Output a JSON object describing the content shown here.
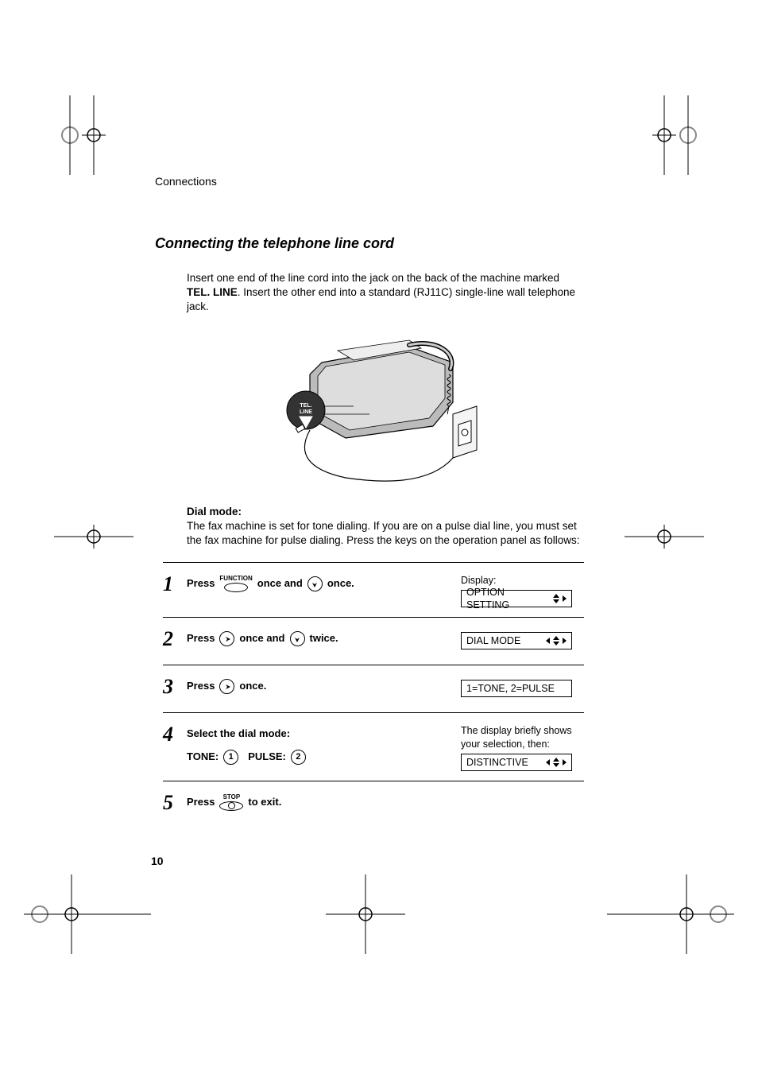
{
  "header": {
    "section": "Connections"
  },
  "title": "Connecting the telephone line cord",
  "intro": {
    "part1": "Insert one end of the line cord into the jack on the back of the machine marked ",
    "bold": "TEL. LINE",
    "part2": ". Insert the other end into a standard (RJ11C) single-line wall telephone jack."
  },
  "illus_label": "TEL. LINE",
  "dialmode": {
    "head": "Dial mode:",
    "text": "The fax machine is set for tone dialing. If you are on a pulse dial line, you must set the fax machine for pulse dialing. Press the keys on the operation panel as follows:"
  },
  "steps": {
    "s1": {
      "num": "1",
      "t1": "Press",
      "key1": "FUNCTION",
      "t2": "once and",
      "t3": "once.",
      "right_label": "Display:",
      "display": "OPTION SETTING"
    },
    "s2": {
      "num": "2",
      "t1": "Press",
      "t2": "once and",
      "t3": "twice.",
      "display": "DIAL MODE"
    },
    "s3": {
      "num": "3",
      "t1": "Press",
      "t2": "once.",
      "display": "1=TONE, 2=PULSE"
    },
    "s4": {
      "num": "4",
      "t1": "Select the dial mode:",
      "tone": "TONE:",
      "key_tone": "1",
      "pulse": "PULSE:",
      "key_pulse": "2",
      "right_text": "The display briefly shows your selection, then:",
      "display": "DISTINCTIVE"
    },
    "s5": {
      "num": "5",
      "t1": "Press",
      "key1": "STOP",
      "t2": "to exit."
    }
  },
  "page_num": "10"
}
